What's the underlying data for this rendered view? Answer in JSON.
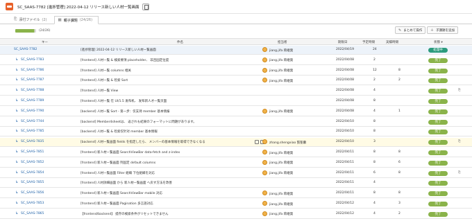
{
  "window": {
    "title": "SC_SAAS-7782 [進捗管理] 2022-04-12 リリース新しい人材一覧画面"
  },
  "tabs": [
    {
      "label": "添付ファイル",
      "count": "(2)",
      "icon": "paperclip-icon"
    },
    {
      "label": "親子課題",
      "count": "(24/26)",
      "icon": "subtask-icon",
      "active": true
    }
  ],
  "toolbar": {
    "progress_label": "(24/26)",
    "progress_fraction": 0.92,
    "bulk_button": "まとめて操作",
    "add_child_button": "子課題を追加",
    "progress_color": "#8ab34a"
  },
  "columns": {
    "key": "キー",
    "summary": "件名",
    "assignee": "担当者",
    "due": "期限日",
    "estimate": "予定時間",
    "actual": "実績時間",
    "status": "状態"
  },
  "status_colors": {
    "処理中": "#2b9b7d",
    "完了": "#8ab34a"
  },
  "rows": [
    {
      "key": "SC_SAAS-7782",
      "summary": "[進捗管理] 2022-04-12 リリース新しい人材一覧画面",
      "assignee": "jiang.jifa 蒋継発",
      "due": "2022/04/19",
      "est": "24",
      "act": "",
      "status": "処理中",
      "parent": true,
      "clip": false
    },
    {
      "key": "SC_SAAS-7783",
      "summary": "[frontend] 人材一覧 & 検索要項 placeholder、 非且固定位度",
      "assignee": "jiang.jifa 蒋継発",
      "due": "2022/04/08",
      "est": "2",
      "act": "",
      "status": "完了",
      "clip": false
    },
    {
      "key": "SC_SAAS-7786",
      "summary": "[frontend] 人材一覧 columns 相关",
      "assignee": "jiang.jifa 蒋継発",
      "due": "2022/04/08",
      "est": "12",
      "act": "8",
      "status": "完了",
      "clip": false
    },
    {
      "key": "SC_SAAS-7787",
      "summary": "[frontend] 人材一覧 & 检索 Sort",
      "assignee": "jiang.jifa 蒋継発",
      "due": "2022/04/08",
      "est": "2",
      "act": "2",
      "status": "完了",
      "clip": false
    },
    {
      "key": "SC_SAAS-7788",
      "summary": "[frontend] 人材一覧 View",
      "assignee": "",
      "due": "2022/04/08",
      "est": "4",
      "act": "",
      "status": "完了",
      "clip": true
    },
    {
      "key": "SC_SAAS-7789",
      "summary": "[frontend] 人材一覧 在 UI/1.5 发布机、 发布新人才一覧页面",
      "assignee": "",
      "due": "2022/04/08",
      "est": "8",
      "act": "",
      "status": "完了",
      "clip": false
    },
    {
      "key": "SC_SAAS-7790",
      "summary": "[backend] 人材一覧 Sort - 第一步：仅支持 member 基本情报",
      "assignee": "jiang.jifa 蒋継発",
      "due": "2022/04/08",
      "est": "4",
      "act": "1",
      "status": "完了",
      "clip": false
    },
    {
      "key": "SC_SAAS-7744",
      "summary": "[backend] Member4sheetは、 返されも結果のフォーマットに問題があります。",
      "assignee": "",
      "due": "2022/04/10",
      "est": "8",
      "act": "",
      "status": "完了",
      "clip": false
    },
    {
      "key": "SC_SAAS-7785",
      "summary": "[backend] 人材一覧 & 检索仅针对 member 基本情報",
      "assignee": "",
      "due": "2022/04/10",
      "est": "8",
      "act": "",
      "status": "完了",
      "clip": false
    },
    {
      "key": "SC_SAAS-7835",
      "summary": "[backend] 人材一覧画面 fields を指定したら、 メンバーの基本情報を取得できなくなる",
      "assignee": "zhang.shengxiao 張聖蕭",
      "due": "2022/04/10",
      "est": "3",
      "act": "",
      "status": "完了",
      "clip": true,
      "highlight": true
    },
    {
      "key": "SC_SAAS-7851",
      "summary": "[frontend] 新人材一覧画面 SearchViewBar data-fetch and z-index",
      "assignee": "jiang.jifa 蒋継発",
      "due": "2022/04/11",
      "est": "8",
      "act": "8",
      "status": "完了",
      "clip": false
    },
    {
      "key": "SC_SAAS-7852",
      "summary": "[frontend] 新人材一覧画面 列固定 default columns",
      "assignee": "jiang.jifa 蒋継発",
      "due": "2022/04/11",
      "est": "8",
      "act": "6",
      "status": "完了",
      "clip": false
    },
    {
      "key": "SC_SAAS-7854",
      "summary": "[frontend] 人材一覧画面 Filter 組織 下位組織を対応",
      "assignee": "jiang.jifa 蒋継発",
      "due": "2022/04/11",
      "est": "6",
      "act": "8",
      "status": "完了",
      "clip": true
    },
    {
      "key": "SC_SAAS-7855",
      "summary": "[frontend] 人材詳細画面 から 新人材一覧画面 へ戻す方法を改善",
      "assignee": "",
      "due": "2022/04/11",
      "est": "4",
      "act": "",
      "status": "完了",
      "clip": false
    },
    {
      "key": "SC_SAAS-7856",
      "summary": "[frontend] 新人材一覧画面 SearchViewBar mobile 対応",
      "assignee": "jiang.jifa 蒋継発",
      "due": "2022/04/11",
      "est": "8",
      "act": "8",
      "status": "完了",
      "clip": false
    },
    {
      "key": "SC_SAAS-7853",
      "summary": "[frontend] 新人材一覧画面 Pagination 多言語対応",
      "assignee": "jiang.jifa 蒋継発",
      "due": "2022/04/12",
      "est": "4",
      "act": "3",
      "status": "完了",
      "clip": false
    },
    {
      "key": "SC_SAAS-7865",
      "summary": "【frontend/backend】 提存の検索条件がリセットできません",
      "assignee": "jiang.jifa 蒋継発",
      "due": "2022/04/12",
      "est": "4",
      "act": "2",
      "status": "完了",
      "clip": false
    }
  ]
}
